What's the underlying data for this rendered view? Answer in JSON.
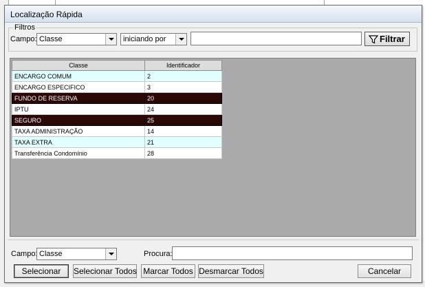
{
  "window": {
    "title": "Localização Rápida"
  },
  "filtros": {
    "legend": "Filtros",
    "campo_label": "Campo:",
    "campo_value": "Classe",
    "modo_value": "iniciando por",
    "texto_value": "",
    "filtrar_label": "Filtrar"
  },
  "grid": {
    "columns": [
      "Classe",
      "Identificador"
    ],
    "rows": [
      {
        "classe": "ENCARGO COMUM",
        "id": "2"
      },
      {
        "classe": "ENCARGO ESPECIFICO",
        "id": "3"
      },
      {
        "classe": "FUNDO DE RESERVA",
        "id": "20"
      },
      {
        "classe": "IPTU",
        "id": "24"
      },
      {
        "classe": "SEGURO",
        "id": "25"
      },
      {
        "classe": "TAXA ADMINISTRAÇÃO",
        "id": "14"
      },
      {
        "classe": "TAXA EXTRA",
        "id": "21"
      },
      {
        "classe": "Transferência Condomínio",
        "id": "28"
      }
    ]
  },
  "bottom": {
    "campo_label": "Campo:",
    "campo_value": "Classe",
    "procura_label": "Procura:",
    "procura_value": "",
    "buttons": {
      "selecionar": "Selecionar",
      "selecionar_todos": "Selecionar Todos",
      "marcar_todos": "Marcar Todos",
      "desmarcar_todos": "Desmarcar Todos",
      "cancelar": "Cancelar"
    }
  },
  "colors": {
    "selected_row": "#2b0707",
    "alt_row": "#e1ffff",
    "grid_bg": "#aaaaaa"
  },
  "icons": {
    "filtrar": "funnel-icon"
  }
}
